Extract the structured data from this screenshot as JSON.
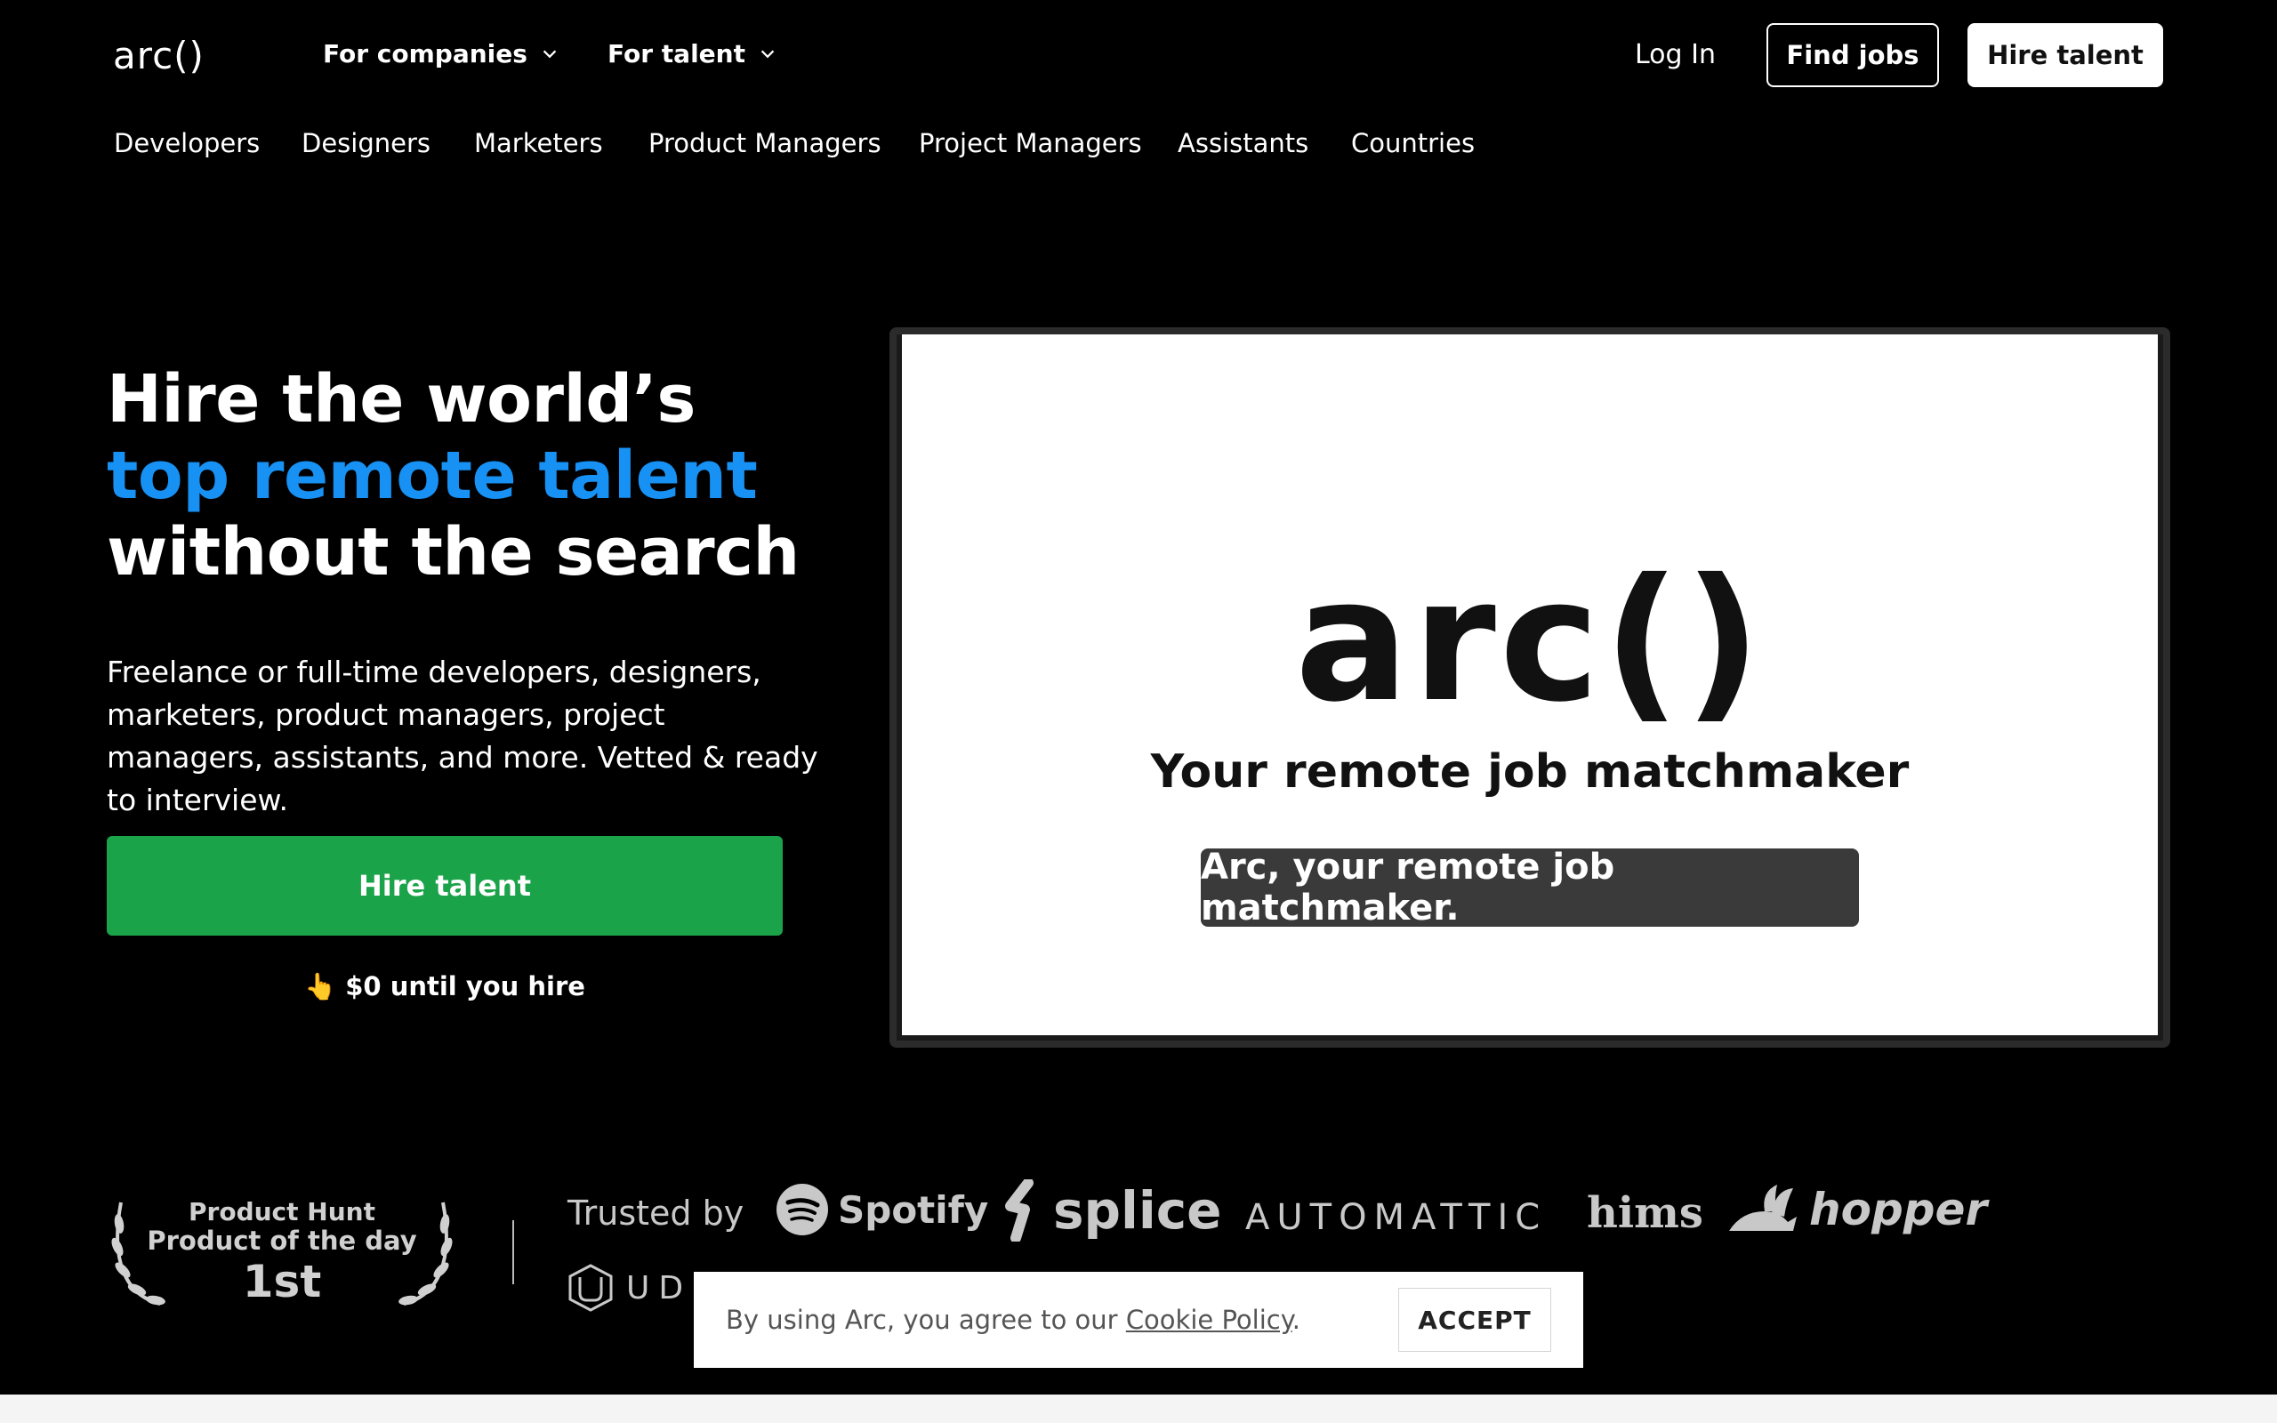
{
  "header": {
    "logo": "arc()",
    "menus": [
      {
        "label": "For companies"
      },
      {
        "label": "For talent"
      }
    ],
    "login": "Log In",
    "find_jobs": "Find jobs",
    "hire_talent": "Hire talent"
  },
  "subnav": [
    "Developers",
    "Designers",
    "Marketers",
    "Product Managers",
    "Project Managers",
    "Assistants",
    "Countries"
  ],
  "hero": {
    "title_line1": "Hire the world’s",
    "title_line2": "top remote talent",
    "title_line3": "without the search",
    "description": "Freelance or full-time developers, designers, marketers, product managers, project managers, assistants, and more. Vetted & ready to interview.",
    "cta": "Hire talent",
    "note_emoji": "👆",
    "note": "$0 until you hire",
    "accent_color": "#1791f4",
    "cta_color": "#1ba34a"
  },
  "video": {
    "logo": "arc()",
    "tagline": "Your remote job matchmaker",
    "caption": "Arc, your remote job matchmaker."
  },
  "trusted": {
    "badge_line1": "Product Hunt",
    "badge_line2": "Product of the day",
    "badge_rank": "1st",
    "label": "Trusted by",
    "logos": {
      "spotify": "Spotify",
      "splice": "splice",
      "automattic": "AUTOMATTIC",
      "hims": "hims",
      "hopper": "hopper",
      "udacity": "UD"
    }
  },
  "cookie": {
    "text_before": "By using Arc, you agree to our ",
    "link": "Cookie Policy",
    "text_after": ".",
    "accept": "ACCEPT"
  }
}
